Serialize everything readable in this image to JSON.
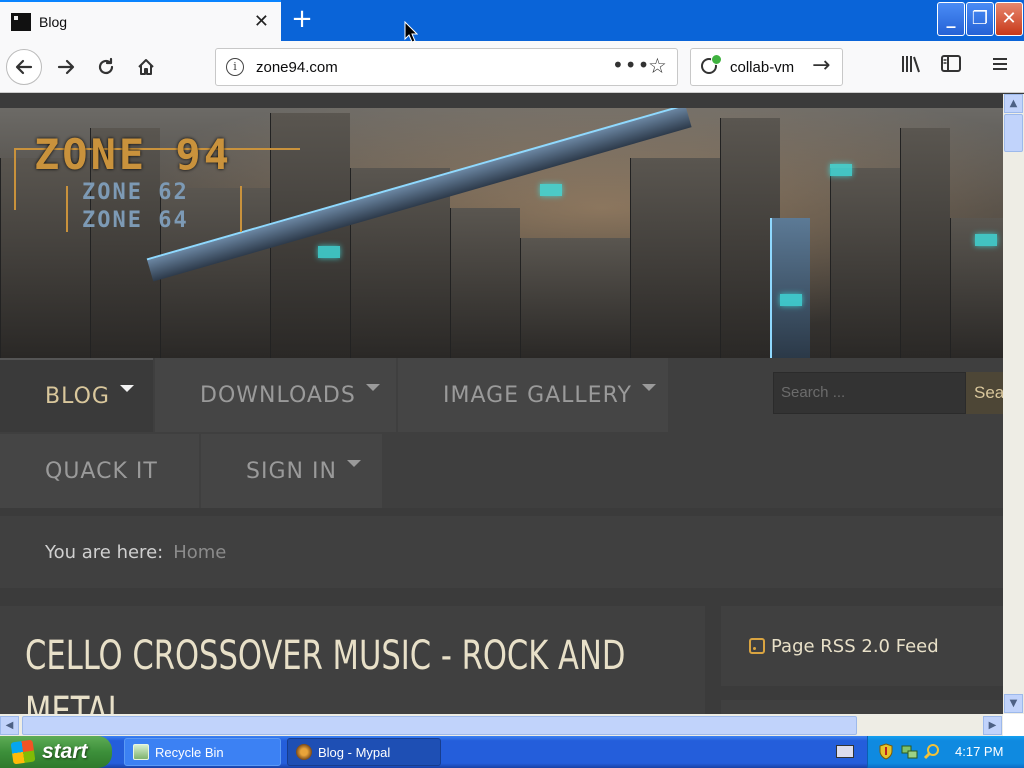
{
  "browser": {
    "tab_title": "Blog",
    "tab_close": "✕",
    "new_tab": "+",
    "url": "zone94.com",
    "url_actions": "•••",
    "search_text": "collab-vm",
    "window_buttons": {
      "minimize": "_",
      "maximize": "❐",
      "close": "✕"
    }
  },
  "site": {
    "logo_main": "ZONE 94",
    "logo_sub_1": "ZONE 62",
    "logo_sub_2": "ZONE 64",
    "menu": [
      {
        "label": "BLOG",
        "active": true,
        "has_dropdown": true
      },
      {
        "label": "DOWNLOADS",
        "active": false,
        "has_dropdown": true
      },
      {
        "label": "IMAGE GALLERY",
        "active": false,
        "has_dropdown": true
      },
      {
        "label": "QUACK IT",
        "active": false,
        "has_dropdown": false
      },
      {
        "label": "SIGN IN",
        "active": false,
        "has_dropdown": true
      }
    ],
    "search_placeholder": "Search ...",
    "search_button": "Search",
    "breadcrumb_label": "You are here:",
    "breadcrumb_home": "Home",
    "article_title": "CELLO CROSSOVER MUSIC - ROCK AND METAL",
    "rss_label": "Page RSS 2.0 Feed"
  },
  "taskbar": {
    "start_label": "start",
    "items": [
      {
        "label": "Recycle Bin"
      },
      {
        "label": "Blog - Mypal"
      }
    ],
    "clock": "4:17 PM"
  },
  "colors": {
    "accent_gold": "#d9c79c",
    "logo_orange": "#c9923c",
    "xp_blue": "#245edb",
    "xp_green": "#3c8f3a"
  }
}
